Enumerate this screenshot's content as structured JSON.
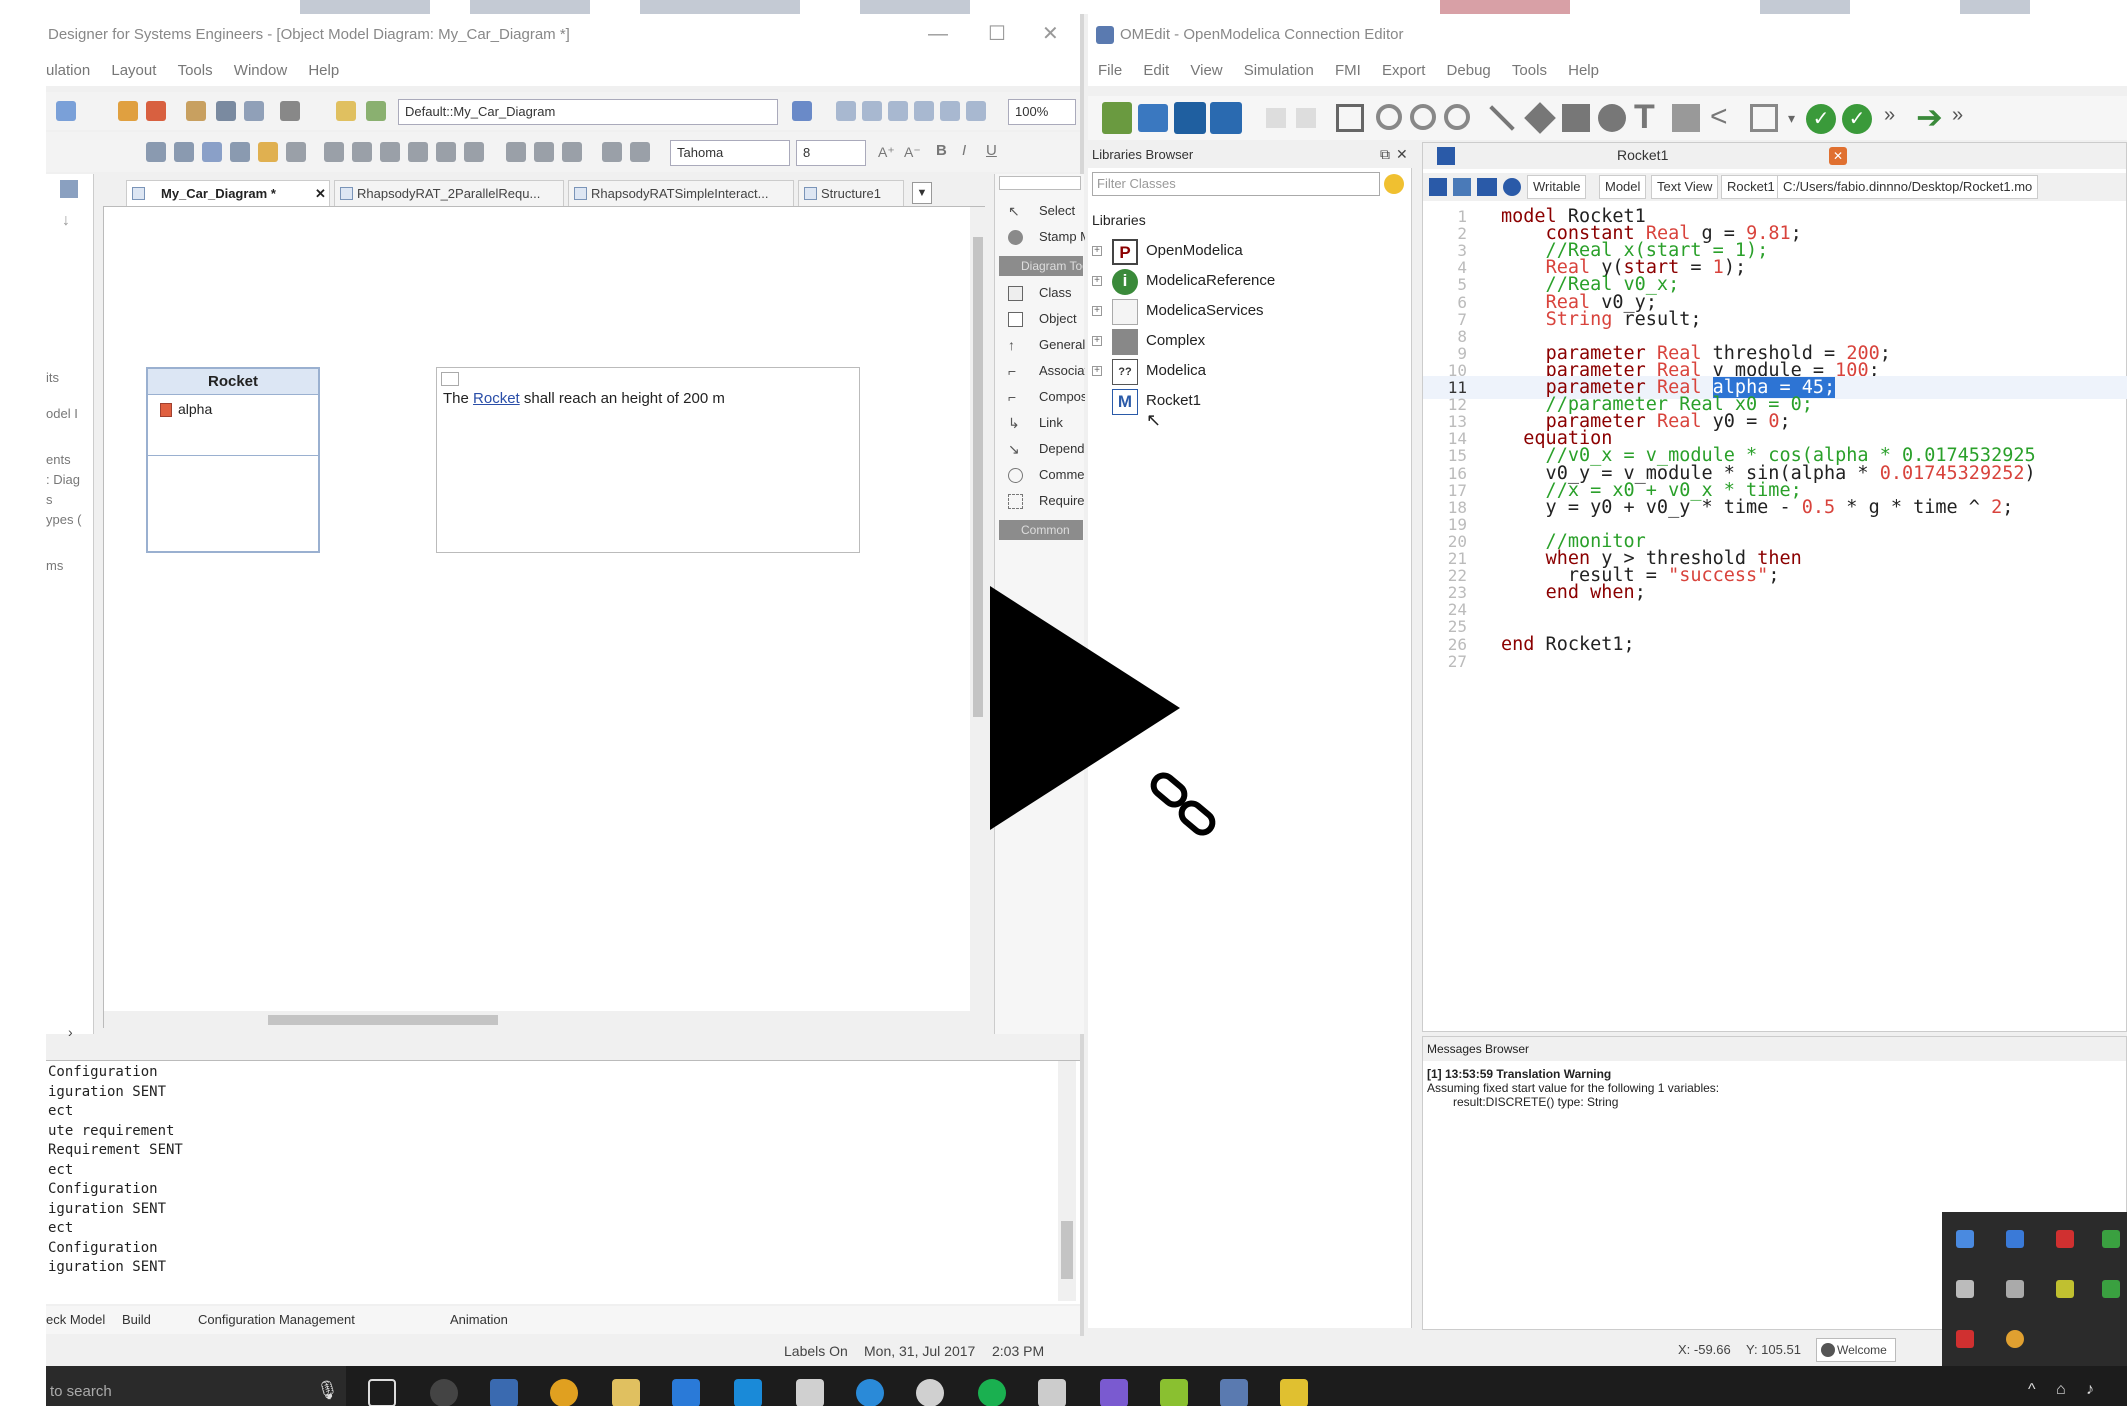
{
  "left_app": {
    "title": "Designer for Systems Engineers - [Object Model Diagram: My_Car_Diagram *]",
    "menu": [
      "ulation",
      "Layout",
      "Tools",
      "Window",
      "Help"
    ],
    "diagram_combo": "Default::My_Car_Diagram",
    "zoom": "100%",
    "font_combo": "Tahoma",
    "font_size": "8",
    "tabs": [
      "My_Car_Diagram *",
      "RhapsodyRAT_2ParallelRequ...",
      "RhapsodyRATSimpleInteract...",
      "Structure1"
    ],
    "browser_items": [
      "its",
      "odel I",
      "ents",
      ": Diag",
      "s",
      "ypes (",
      "ms"
    ],
    "class_box": {
      "name": "Rocket",
      "attribute": "alpha"
    },
    "requirement": {
      "prefix": "The ",
      "link": "Rocket",
      "suffix": " shall reach an height of 200 m"
    },
    "palette": {
      "items_top": [
        "Select",
        "Stamp M"
      ],
      "section": "Diagram Tool",
      "items": [
        "Class",
        "Object",
        "Generaliz",
        "Associati",
        "Composi",
        "Link",
        "Depende",
        "Comment",
        "Requirer"
      ],
      "section2": "Common"
    },
    "output_lines": [
      "Configuration",
      "iguration SENT",
      "ect",
      "ute requirement",
      "Requirement SENT",
      "ect",
      "Configuration",
      "iguration SENT",
      "ect",
      "Configuration",
      "iguration SENT"
    ],
    "bottom_tabs": [
      "eck Model",
      "Build",
      "Configuration Management",
      "Animation"
    ],
    "status": {
      "labels": "Labels On",
      "date": "Mon, 31, Jul 2017",
      "time": "2:03 PM"
    }
  },
  "right_app": {
    "title": "OMEdit - OpenModelica Connection Editor",
    "menu": [
      "File",
      "Edit",
      "View",
      "Simulation",
      "FMI",
      "Export",
      "Debug",
      "Tools",
      "Help"
    ],
    "libraries_header": "Libraries Browser",
    "filter_placeholder": "Filter Classes",
    "libraries_label": "Libraries",
    "libraries": [
      {
        "name": "OpenModelica",
        "icon": "P"
      },
      {
        "name": "ModelicaReference",
        "icon": "i"
      },
      {
        "name": "ModelicaServices",
        "icon": ""
      },
      {
        "name": "Complex",
        "icon": ""
      },
      {
        "name": "Modelica",
        "icon": "??"
      },
      {
        "name": "Rocket1",
        "icon": "M"
      }
    ],
    "editor_title": "Rocket1",
    "editor_bar": [
      "Writable",
      "Model",
      "Text View",
      "Rocket1",
      "C:/Users/fabio.dinnno/Desktop/Rocket1.mo"
    ],
    "code_lines": [
      "model Rocket1",
      "    constant Real g = 9.81;",
      "    //Real x(start = 1);",
      "    Real y(start = 1);",
      "    //Real v0_x;",
      "    Real v0_y;",
      "    String result;",
      "",
      "    parameter Real threshold = 200;",
      "    parameter Real v_module = 100;",
      "    parameter Real alpha = 45;",
      "    //parameter Real x0 = 0;",
      "    parameter Real y0 = 0;",
      "  equation",
      "    //v0_x = v_module * cos(alpha * 0.0174532925",
      "    v0_y = v_module * sin(alpha * 0.01745329252)",
      "    //x = x0 + v0_x * time;",
      "    y = y0 + v0_y * time - 0.5 * g * time ^ 2;",
      "",
      "    //monitor",
      "    when y > threshold then",
      "      result = \"success\";",
      "    end when;",
      "",
      "",
      "end Rocket1;",
      ""
    ],
    "messages_header": "Messages Browser",
    "message_title": "[1] 13:53:59 Translation Warning",
    "message_body1": "Assuming fixed start value for the following 1 variables:",
    "message_body2": "result:DISCRETE() type: String",
    "status_x": "X: -59.66",
    "status_y": "Y: 105.51",
    "welcome": "Welcome"
  },
  "taskbar": {
    "search": "to search"
  }
}
